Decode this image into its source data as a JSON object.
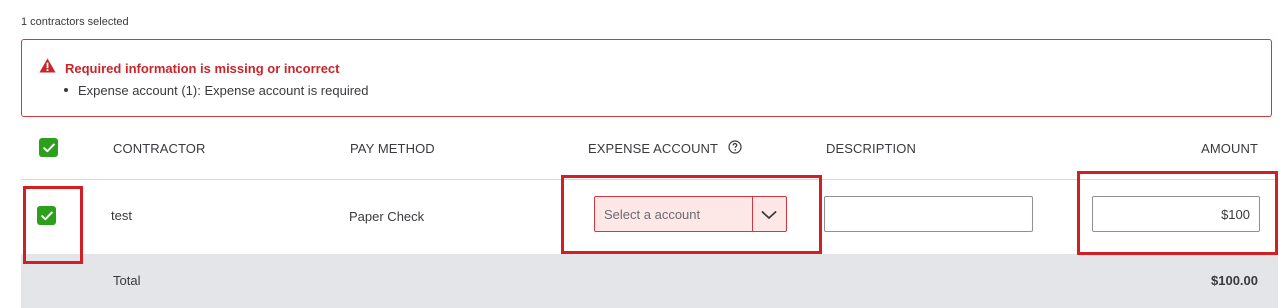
{
  "selection_status": "1 contractors selected",
  "error": {
    "title": "Required information is missing or incorrect",
    "items": [
      "Expense account (1): Expense account is required"
    ],
    "icon": "warning-icon",
    "color": "#c9252b"
  },
  "table": {
    "headers": {
      "contractor": "CONTRACTOR",
      "pay_method": "PAY METHOD",
      "expense_account": "EXPENSE ACCOUNT",
      "description": "DESCRIPTION",
      "amount": "AMOUNT"
    },
    "header_checkbox_checked": true,
    "rows": [
      {
        "checked": true,
        "contractor": "test",
        "pay_method": "Paper Check",
        "expense_account_placeholder": "Select a account",
        "description": "",
        "amount": "$100"
      }
    ],
    "total": {
      "label": "Total",
      "value": "$100.00"
    }
  },
  "colors": {
    "accent_green": "#2ca01c",
    "error_red": "#d1393e",
    "annotation_red": "#d21f26",
    "total_row_bg": "#e3e5e8"
  }
}
